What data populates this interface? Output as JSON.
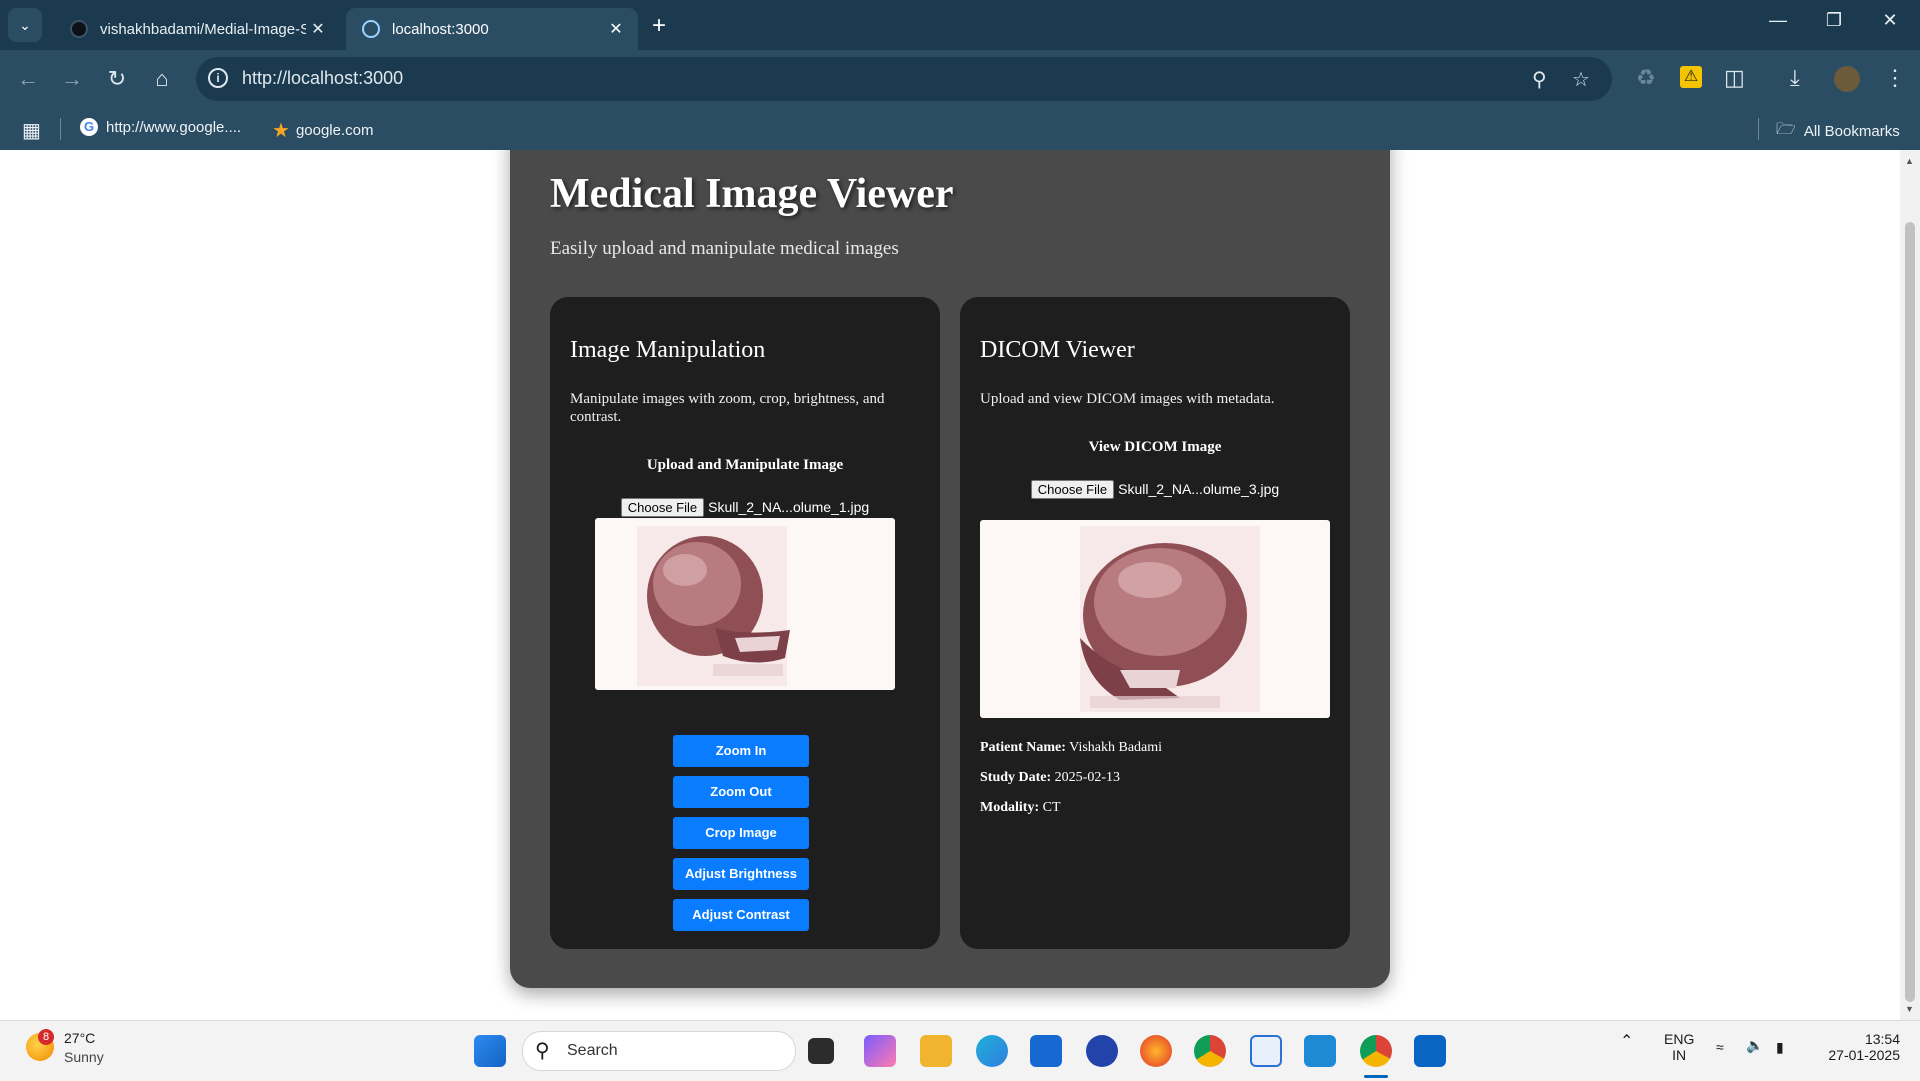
{
  "browser": {
    "tabs": [
      {
        "title": "vishakhbadami/Medial-Image-S",
        "active": false
      },
      {
        "title": "localhost:3000",
        "active": true
      }
    ],
    "new_tab_label": "+",
    "url": "http://localhost:3000",
    "bookmarks": [
      {
        "label": "http://www.google...."
      },
      {
        "label": "google.com"
      }
    ],
    "all_bookmarks_label": "All Bookmarks"
  },
  "app": {
    "title": "Medical Image Viewer",
    "subtitle": "Easily upload and manipulate medical images",
    "manipulation": {
      "heading": "Image Manipulation",
      "description": "Manipulate images with zoom, crop, brightness, and contrast.",
      "upload_heading": "Upload and Manipulate Image",
      "choose_label": "Choose File",
      "file_name": "Skull_2_NA...olume_1.jpg",
      "buttons": [
        "Zoom In",
        "Zoom Out",
        "Crop Image",
        "Adjust Brightness",
        "Adjust Contrast"
      ]
    },
    "dicom": {
      "heading": "DICOM Viewer",
      "description": "Upload and view DICOM images with metadata.",
      "view_heading": "View DICOM Image",
      "choose_label": "Choose File",
      "file_name": "Skull_2_NA...olume_3.jpg",
      "metadata": [
        {
          "label": "Patient Name:",
          "value": "Vishakh Badami"
        },
        {
          "label": "Study Date:",
          "value": "2025-02-13"
        },
        {
          "label": "Modality:",
          "value": "CT"
        }
      ]
    },
    "colors": {
      "panel": "#4a4a4a",
      "card": "#1e1e1e",
      "button": "#0a7cff"
    }
  },
  "taskbar": {
    "weather_badge": "8",
    "temperature": "27°C",
    "condition": "Sunny",
    "search_label": "Search",
    "language": "ENG",
    "region": "IN",
    "time": "13:54",
    "date": "27-01-2025"
  }
}
